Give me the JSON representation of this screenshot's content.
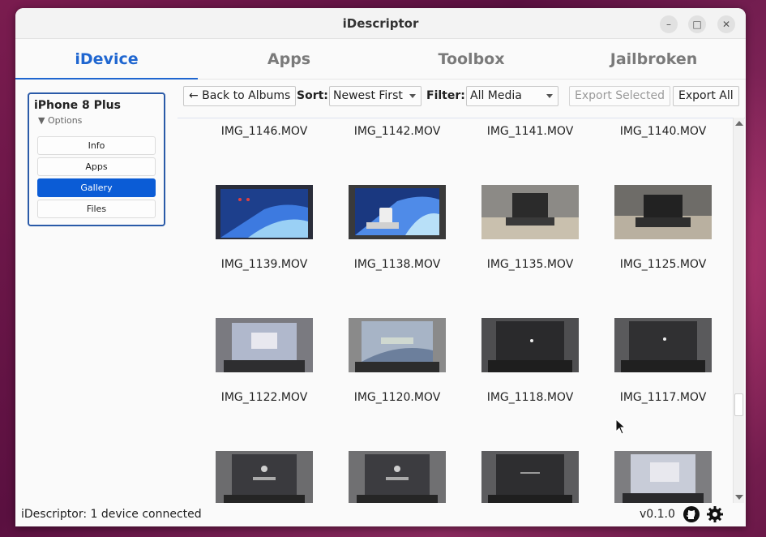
{
  "window": {
    "title": "iDescriptor"
  },
  "tabs": [
    {
      "label": "iDevice",
      "active": true
    },
    {
      "label": "Apps",
      "active": false
    },
    {
      "label": "Toolbox",
      "active": false
    },
    {
      "label": "Jailbroken",
      "active": false
    }
  ],
  "sidebar": {
    "device_name": "iPhone 8 Plus",
    "options_label": "▼ Options",
    "items": [
      {
        "label": "Info",
        "active": false
      },
      {
        "label": "Apps",
        "active": false
      },
      {
        "label": "Gallery",
        "active": true
      },
      {
        "label": "Files",
        "active": false
      }
    ]
  },
  "toolbar": {
    "back_label": "← Back to Albums",
    "sort_label": "Sort:",
    "sort_value": "Newest First",
    "filter_label": "Filter:",
    "filter_value": "All Media",
    "export_selected_label": "Export Selected",
    "export_all_label": "Export All"
  },
  "gallery": {
    "items": [
      "IMG_1146.MOV",
      "IMG_1142.MOV",
      "IMG_1141.MOV",
      "IMG_1140.MOV",
      "IMG_1139.MOV",
      "IMG_1138.MOV",
      "IMG_1135.MOV",
      "IMG_1125.MOV",
      "IMG_1122.MOV",
      "IMG_1120.MOV",
      "IMG_1118.MOV",
      "IMG_1117.MOV"
    ]
  },
  "status": {
    "text": "iDescriptor: 1 device connected",
    "version": "v0.1.0"
  },
  "icons": {
    "github": "github-icon",
    "settings": "gear-icon"
  },
  "colors": {
    "accent": "#1f66d0",
    "selected_button": "#0b5cd6",
    "sidebar_border": "#2a5aa8"
  }
}
